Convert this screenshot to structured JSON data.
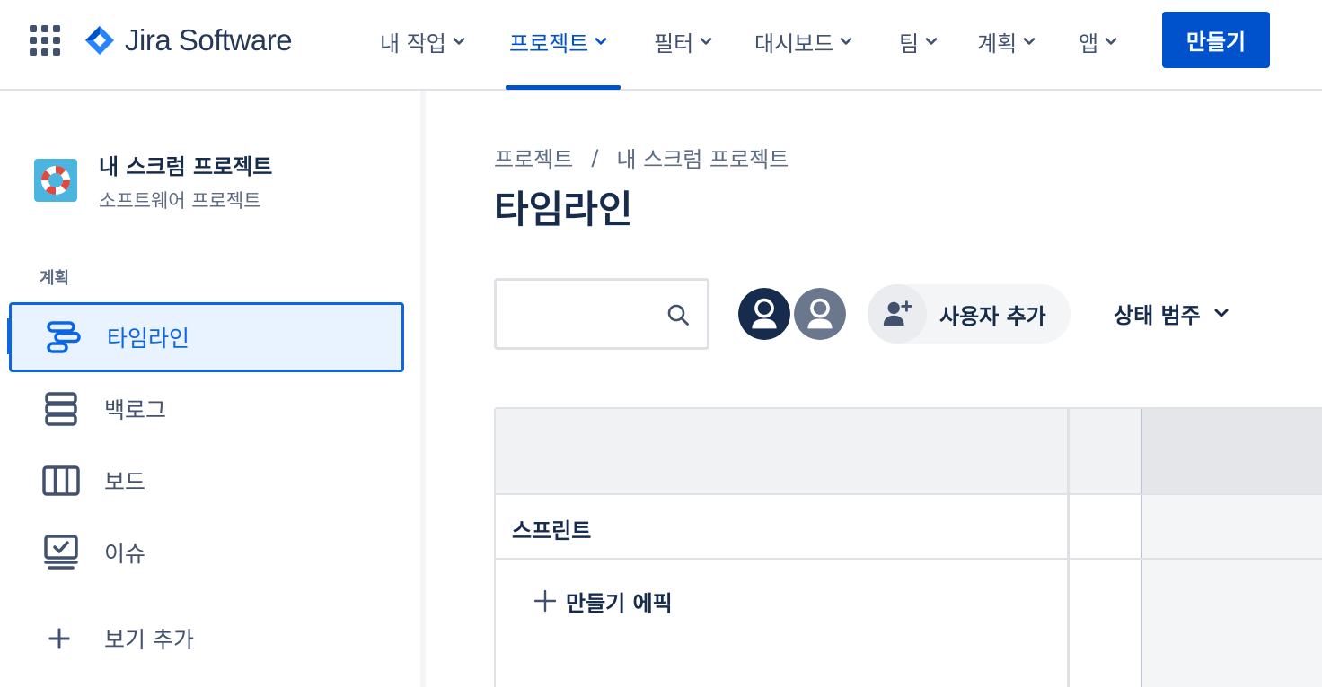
{
  "app": {
    "name": "Jira Software"
  },
  "topnav": {
    "items": [
      {
        "label": "내 작업"
      },
      {
        "label": "프로젝트"
      },
      {
        "label": "필터"
      },
      {
        "label": "대시보드"
      },
      {
        "label": "팀"
      },
      {
        "label": "계획"
      },
      {
        "label": "앱"
      }
    ],
    "active_item": "프로젝트",
    "create_label": "만들기"
  },
  "sidebar": {
    "project_name": "내 스크럼 프로젝트",
    "project_type": "소프트웨어 프로젝트",
    "section_label": "계획",
    "items": [
      {
        "label": "타임라인",
        "icon": "timeline-icon",
        "selected": true
      },
      {
        "label": "백로그",
        "icon": "backlog-icon"
      },
      {
        "label": "보드",
        "icon": "board-icon"
      },
      {
        "label": "이슈",
        "icon": "issues-icon"
      },
      {
        "label": "보기 추가",
        "icon": "plus-icon"
      }
    ]
  },
  "main": {
    "breadcrumbs": [
      "프로젝트",
      "내 스크럼 프로젝트"
    ],
    "breadcrumb_separator": "/",
    "title": "타임라인",
    "search": {
      "value": "",
      "placeholder": ""
    },
    "add_user_label": "사용자 추가",
    "status_filter_label": "상태 범주",
    "timeline": {
      "sprint_label": "스프린트",
      "create_epic_label": "만들기 에픽"
    }
  },
  "colors": {
    "brand": "#0052cc",
    "selected_bg": "#e9f2ff",
    "selected_border": "#0c66e4",
    "text_primary": "#172b4d",
    "text_secondary": "#42526e"
  }
}
